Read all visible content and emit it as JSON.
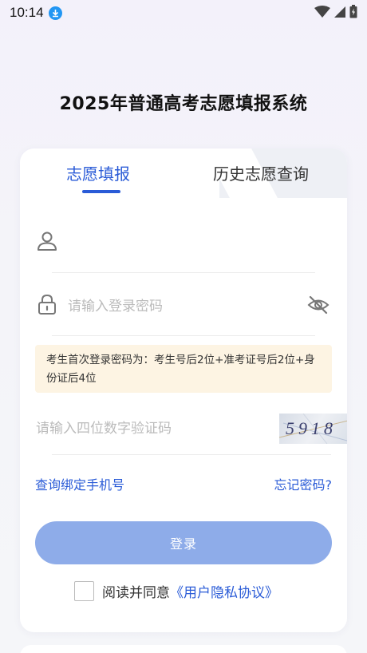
{
  "status_bar": {
    "time": "10:14"
  },
  "app": {
    "title": "2025年普通高考志愿填报系统"
  },
  "tabs": [
    {
      "label": "志愿填报",
      "active": true
    },
    {
      "label": "历史志愿查询",
      "active": false
    }
  ],
  "form": {
    "username_value": "",
    "password_placeholder": "请输入登录密码",
    "hint": "考生首次登录密码为：考生号后2位+准考证号后2位+身份证后4位",
    "captcha_placeholder": "请输入四位数字验证码",
    "captcha_code": "5918",
    "bind_phone_link": "查询绑定手机号",
    "forgot_link": "忘记密码?",
    "login_button": "登录",
    "agree_prefix": "阅读并同意",
    "agree_link": "《用户隐私协议》"
  },
  "colors": {
    "accent": "#2a5bd7",
    "button_disabled": "#8eace9",
    "hint_bg": "#fdf4e3"
  },
  "icons": {
    "download": "download-icon",
    "wifi": "wifi-icon",
    "signal": "signal-icon",
    "battery": "battery-icon",
    "user": "user-icon",
    "lock": "lock-icon",
    "eye_off": "eye-off-icon"
  }
}
